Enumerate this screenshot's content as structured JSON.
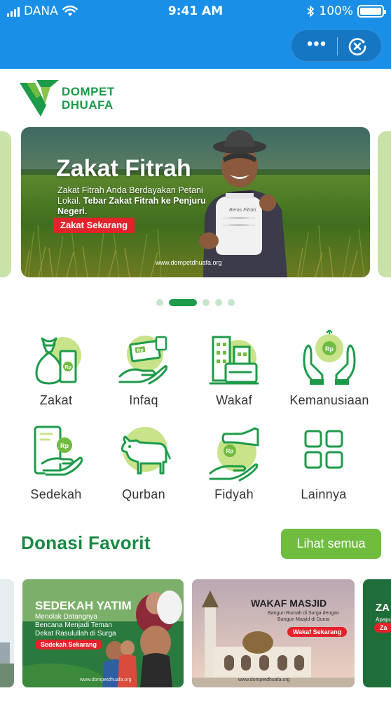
{
  "status_bar": {
    "carrier": "DANA",
    "time": "9:41 AM",
    "battery": "100%"
  },
  "header": {
    "more_label": "•••"
  },
  "logo": {
    "line1": "DOMPET",
    "line2": "DHUAFA"
  },
  "banner": {
    "title": "Zakat Fitrah",
    "subtitle_plain": "Zakat Fitrah Anda Berdayakan Petani Lokal.",
    "subtitle_bold": "Tebar Zakat Fitrah ke Penjuru Negeri.",
    "button": "Zakat Sekarang",
    "url": "www.dompetdhuafa.org",
    "sack_text": "Beras Fitrah"
  },
  "carousel": {
    "count": 5,
    "active_index": 1
  },
  "menu": {
    "items": [
      {
        "label": "Zakat",
        "icon": "money-bag-icon"
      },
      {
        "label": "Infaq",
        "icon": "hand-money-icon"
      },
      {
        "label": "Wakaf",
        "icon": "buildings-icon"
      },
      {
        "label": "Kemanusiaan",
        "icon": "hands-coin-icon"
      },
      {
        "label": "Sedekah",
        "icon": "phone-hand-icon"
      },
      {
        "label": "Qurban",
        "icon": "cow-icon"
      },
      {
        "label": "Fidyah",
        "icon": "hands-give-icon"
      },
      {
        "label": "Lainnya",
        "icon": "grid-icon"
      }
    ]
  },
  "favorites": {
    "title": "Donasi Favorit",
    "see_all": "Lihat semua",
    "cards": [
      {
        "title": "SEDEKAH YATIM",
        "subtitle": "Menolak Datangnya Bencana Menjadi Teman Dekat Rasulullah di Surga",
        "button": "Sedekah Sekarang",
        "url": "www.dompetdhuafa.org"
      },
      {
        "title": "WAKAF MASJID",
        "subtitle": "Bangun Rumah di Surga dengan Bangun Masjid di Dunia",
        "button": "Wakaf Sekarang",
        "url": "www.dompetdhuafa.org"
      },
      {
        "title": "ZA",
        "subtitle": "Apapu",
        "button": "Za"
      }
    ]
  },
  "colors": {
    "header_blue": "#1a8fe8",
    "brand_green": "#1d9b4a",
    "accent_green": "#6fbc3f",
    "cta_red": "#e3232b"
  }
}
